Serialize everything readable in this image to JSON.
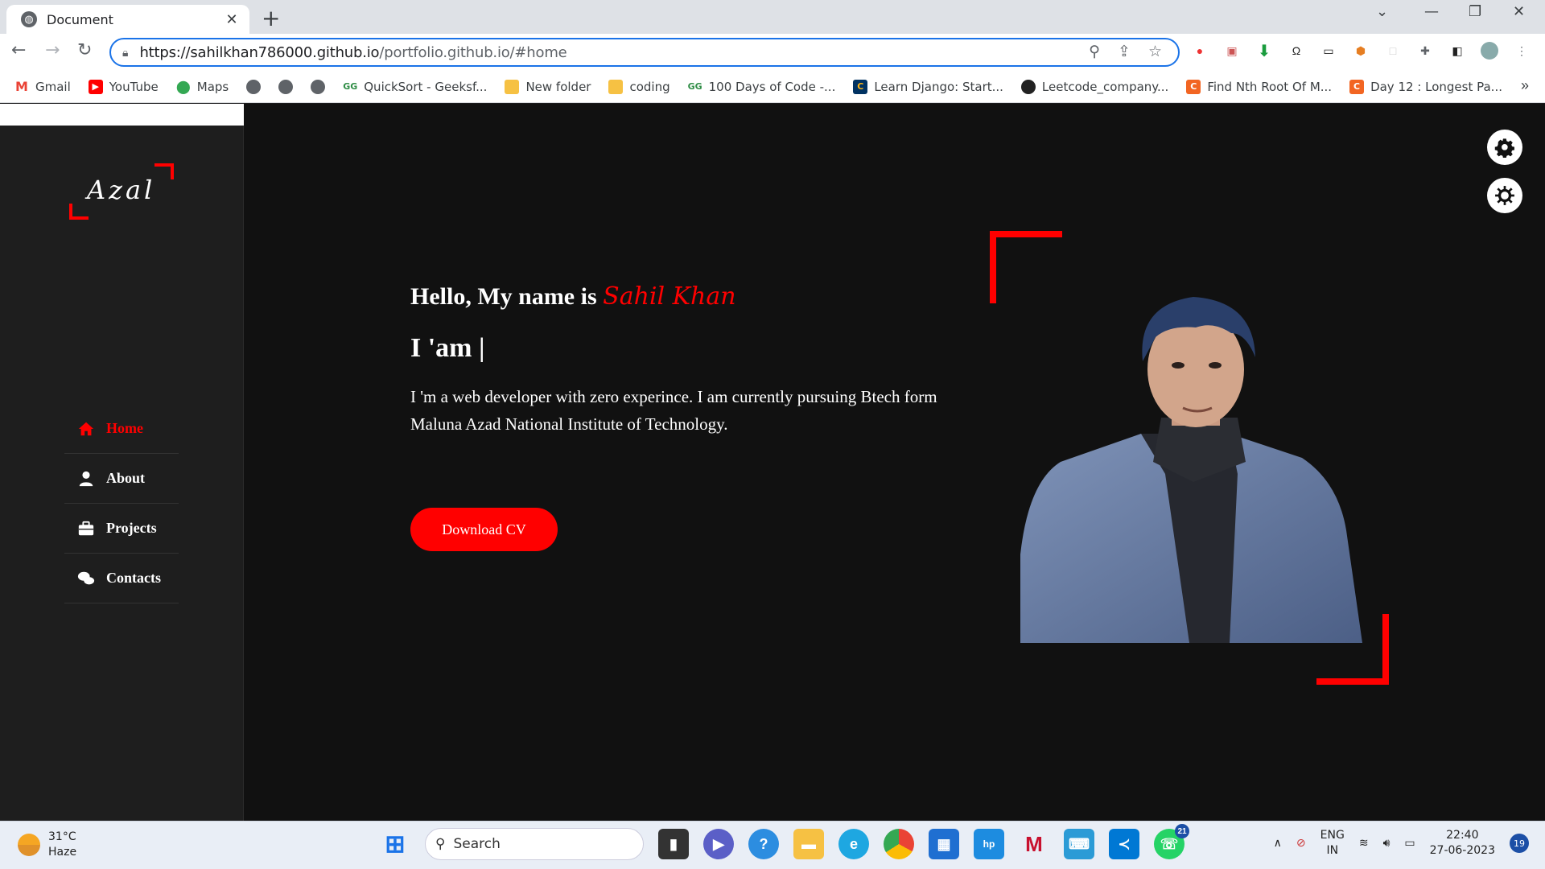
{
  "browser": {
    "tab_title": "Document",
    "url_host": "https://sahilkhan786000.github.io",
    "url_path": "/portfolio.github.io/#home",
    "bookmarks": [
      "Gmail",
      "YouTube",
      "Maps",
      "QuickSort - Geeksf...",
      "New folder",
      "coding",
      "100 Days of Code -...",
      "Learn Django: Start...",
      "Leetcode_company...",
      "Find Nth Root Of M...",
      "Day 12 : Longest Pa..."
    ]
  },
  "sidebar": {
    "logo": "Azal",
    "items": [
      {
        "label": "Home",
        "icon": "home-icon"
      },
      {
        "label": "About",
        "icon": "user-icon"
      },
      {
        "label": "Projects",
        "icon": "briefcase-icon"
      },
      {
        "label": "Contacts",
        "icon": "chat-icon"
      }
    ]
  },
  "hero": {
    "greeting": "Hello, My name is",
    "name": "Sahil Khan",
    "iam": "I 'am |",
    "description": "I 'm a web developer with zero experince. I am currently pursuing Btech form Maluna Azad National Institute of Technology.",
    "cta": "Download CV"
  },
  "taskbar": {
    "temp": "31°C",
    "condition": "Haze",
    "search": "Search",
    "lang1": "ENG",
    "lang2": "IN",
    "time": "22:40",
    "date": "27-06-2023",
    "notifications": "19",
    "whatsapp_badge": "21"
  },
  "colors": {
    "accent": "#ff0000",
    "page_bg": "#111111",
    "sidebar_bg": "#1e1e1e"
  }
}
